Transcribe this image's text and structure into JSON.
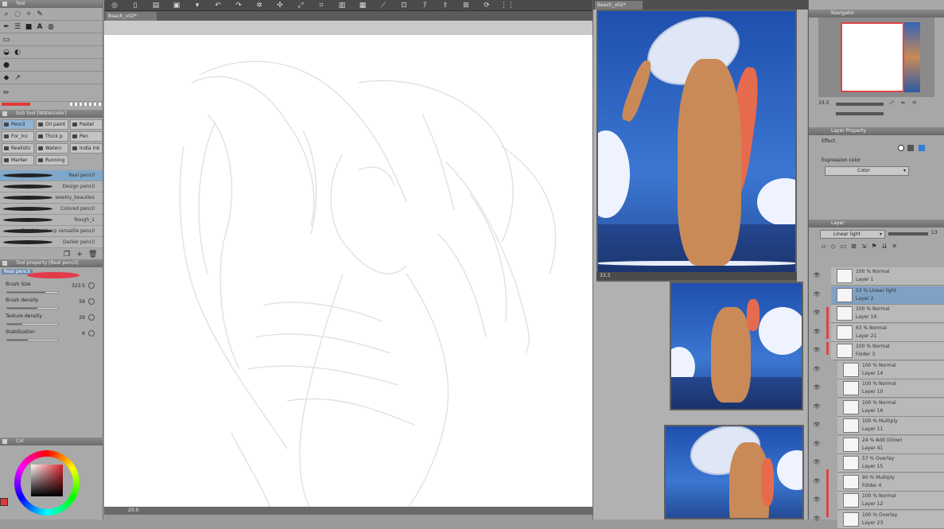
{
  "left_panel": {
    "tool_title": "Tool",
    "sub_tool_title": "Sub tool [Watercolor]",
    "sub_tools": [
      "Pencil",
      "Oil paint",
      "Pastel",
      "For_Inc",
      "Thick p",
      "Pen",
      "Realistic",
      "Waterc",
      "India ink",
      "Marker",
      "Running"
    ],
    "brushes": [
      "Real pencil",
      "Design pencil",
      "weekly_beauties",
      "Colored pencil",
      "Rough_1",
      "Graphite sharp versatile pencil",
      "Darker pencil"
    ],
    "tool_property_title": "Tool property [Real pencil]",
    "brush_name": "Real pencil",
    "props": [
      {
        "label": "Brush Size",
        "value": "323.5",
        "level": 0.75
      },
      {
        "label": "Brush density",
        "value": "59",
        "level": 0.59
      },
      {
        "label": "Texture density",
        "value": "29",
        "level": 0.29
      },
      {
        "label": "Stabilization",
        "value": "6",
        "level": 0.4
      }
    ],
    "color_title": "Col"
  },
  "document": {
    "tab_title": "Beach_v02*",
    "status": "20.0"
  },
  "reference": {
    "tab_title": "Beach_v02*",
    "zoom": "33.3"
  },
  "right_panel": {
    "navigator_title": "Navigator",
    "nav_zoom": "33.3",
    "layer_property_title": "Layer Property",
    "effect_label": "Effect",
    "expression_color_label": "Expression color",
    "expression_color_value": "Color",
    "layer_title": "Layer",
    "blend_mode": "Linear light",
    "opacity": "13",
    "layers": [
      {
        "mode": "100 % Normal",
        "name": "Layer 1",
        "selected": false
      },
      {
        "mode": "53 % Linear light",
        "name": "Layer 2",
        "selected": true
      },
      {
        "mode": "100 % Normal",
        "name": "Layer 19",
        "selected": false
      },
      {
        "mode": "63 % Normal",
        "name": "Layer 21",
        "selected": false
      },
      {
        "mode": "100 % Normal",
        "name": "Folder 3",
        "selected": false
      },
      {
        "mode": "100 % Normal",
        "name": "Layer 14",
        "selected": false
      },
      {
        "mode": "100 % Normal",
        "name": "Layer 10",
        "selected": false
      },
      {
        "mode": "100 % Normal",
        "name": "Layer 16",
        "selected": false
      },
      {
        "mode": "100 % Multiply",
        "name": "Layer 11",
        "selected": false
      },
      {
        "mode": "24 % Add (Glow)",
        "name": "Layer 41",
        "selected": false
      },
      {
        "mode": "57 % Overlay",
        "name": "Layer 15",
        "selected": false
      },
      {
        "mode": "90 % Multiply",
        "name": "Folder 4",
        "selected": false
      },
      {
        "mode": "100 % Normal",
        "name": "Layer 12",
        "selected": false
      },
      {
        "mode": "100 % Overlay",
        "name": "Layer 23",
        "selected": false
      }
    ]
  }
}
